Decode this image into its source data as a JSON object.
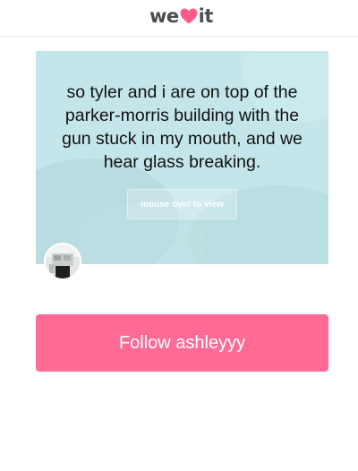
{
  "header": {
    "logo_left": "we",
    "logo_right": "it",
    "logo_icon": "heart-icon",
    "brand_color": "#ff5a8a"
  },
  "post": {
    "quote": "so tyler and i are on top of the parker-morris building with the gun stuck in my mouth, and we hear glass breaking.",
    "reveal_label": "mouse over to view",
    "background_color": "#c4e6ea"
  },
  "user": {
    "avatar": "user-avatar"
  },
  "follow": {
    "label": "Follow ashleyyy",
    "color": "#ff6b95"
  }
}
